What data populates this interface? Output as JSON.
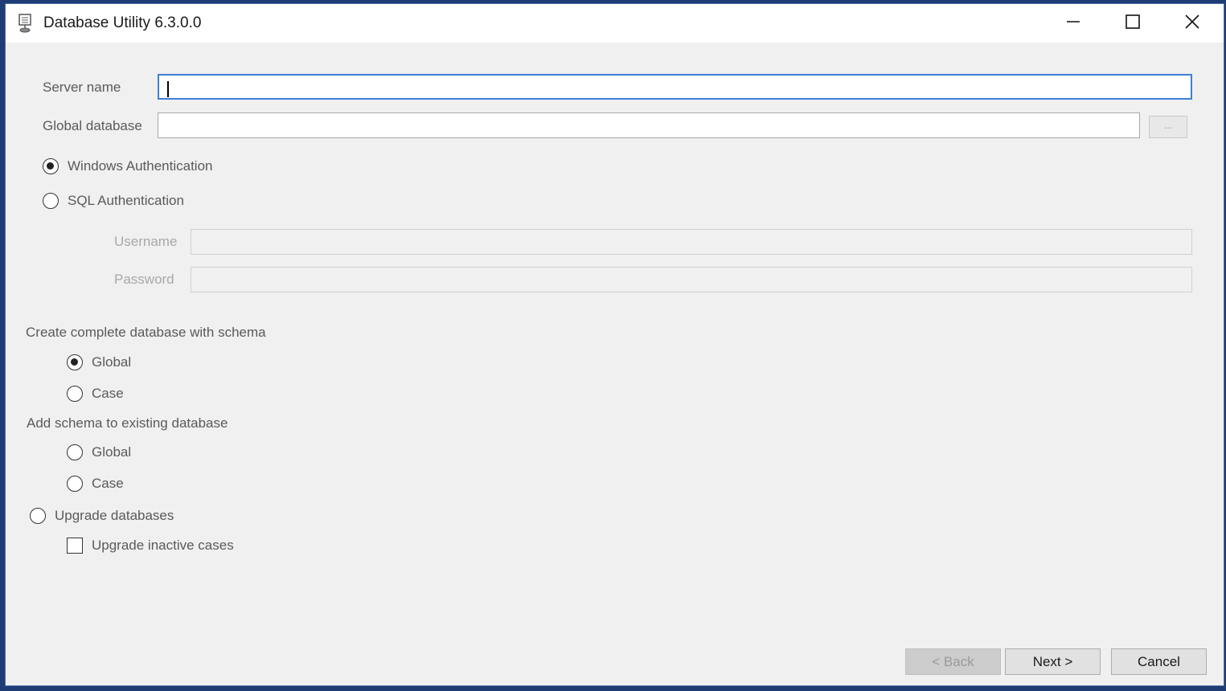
{
  "window": {
    "title": "Database Utility 6.3.0.0",
    "icons": {
      "app": "database-icon",
      "minimize": "minimize-icon",
      "maximize": "maximize-icon",
      "close": "close-icon"
    }
  },
  "connection": {
    "server_name_label": "Server name",
    "server_name_value": "",
    "global_database_label": "Global database",
    "global_database_value": "",
    "browse_label": "..."
  },
  "auth": {
    "windows_label": "Windows Authentication",
    "windows_selected": true,
    "sql_label": "SQL Authentication",
    "sql_selected": false,
    "username_label": "Username",
    "username_value": "",
    "password_label": "Password",
    "password_value": ""
  },
  "create_section": {
    "label": "Create complete database with schema",
    "options": [
      {
        "label": "Global",
        "selected": true
      },
      {
        "label": "Case",
        "selected": false
      }
    ]
  },
  "add_section": {
    "label": "Add schema to existing database",
    "options": [
      {
        "label": "Global",
        "selected": false
      },
      {
        "label": "Case",
        "selected": false
      }
    ]
  },
  "upgrade": {
    "label": "Upgrade databases",
    "selected": false,
    "inactive_label": "Upgrade inactive cases",
    "inactive_checked": false
  },
  "footer": {
    "back_label": "< Back",
    "next_label": "Next >",
    "cancel_label": "Cancel"
  },
  "colors": {
    "accent_focus": "#3d7fd8",
    "window_bg": "#f0f0f0",
    "frame": "#1f3d74"
  }
}
